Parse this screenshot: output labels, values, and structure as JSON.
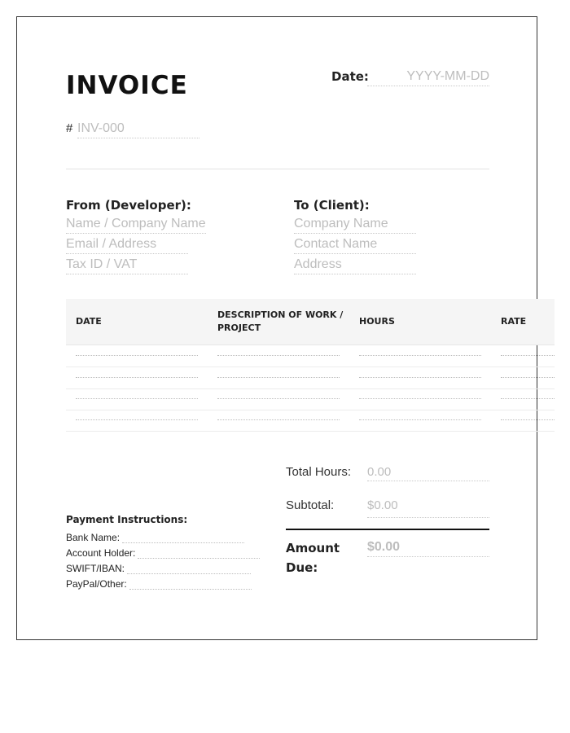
{
  "header": {
    "title": "INVOICE",
    "number_prefix": "#",
    "number_placeholder": "INV-000",
    "date_label": "Date:",
    "date_placeholder": "YYYY-MM-DD"
  },
  "from": {
    "heading": "From (Developer):",
    "fields": [
      "Name / Company Name",
      "Email / Address",
      "Tax ID / VAT"
    ]
  },
  "to": {
    "heading": "To (Client):",
    "fields": [
      "Company Name",
      "Contact Name",
      "Address"
    ]
  },
  "table": {
    "columns": [
      "DATE",
      "DESCRIPTION OF WORK / PROJECT",
      "HOURS",
      "RATE"
    ],
    "row_count": 4
  },
  "totals": {
    "total_hours_label": "Total Hours:",
    "total_hours_value": "0.00",
    "subtotal_label": "Subtotal:",
    "subtotal_value": "$0.00",
    "amount_due_label": "Amount Due:",
    "amount_due_value": "$0.00"
  },
  "payment": {
    "heading": "Payment Instructions:",
    "lines": [
      "Bank Name:",
      "Account Holder:",
      "SWIFT/IBAN:",
      "PayPal/Other:"
    ]
  }
}
